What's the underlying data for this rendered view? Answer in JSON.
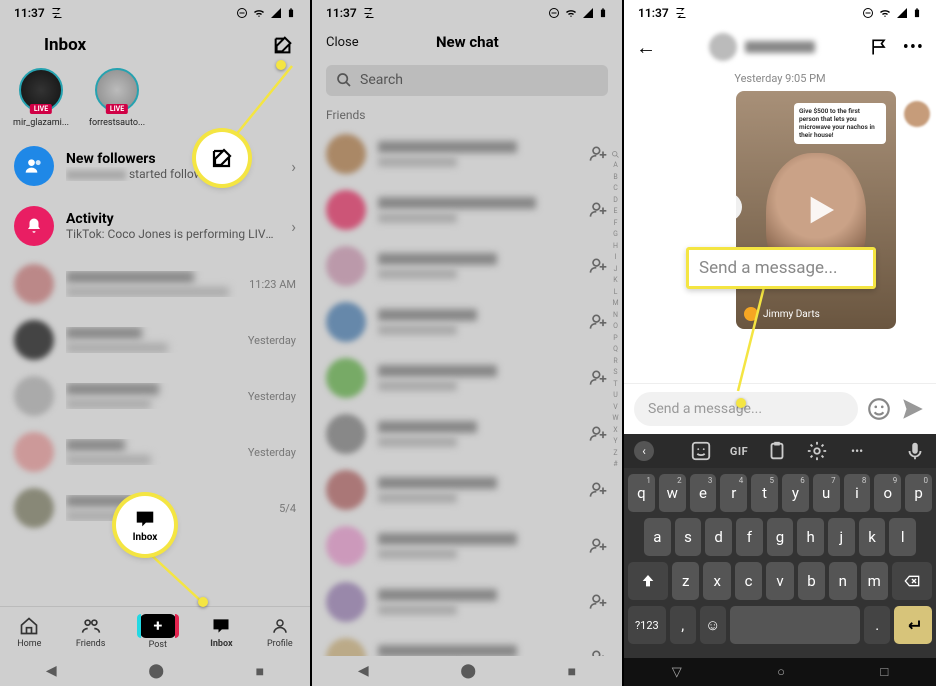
{
  "status_time": "11:37",
  "panel1": {
    "title": "Inbox",
    "stories": [
      "mir_glazami...",
      "forrestsauto..."
    ],
    "new_followers": {
      "title": "New followers",
      "sub": "started following you."
    },
    "activity": {
      "title": "Activity",
      "sub": "TikTok: Coco Jones is performing LIVE on TikT..."
    },
    "times": [
      "11:23 AM",
      "Yesterday",
      "Yesterday",
      "Yesterday",
      "5/4"
    ],
    "tabs": {
      "home": "Home",
      "friends": "Friends",
      "post": "Post",
      "inbox": "Inbox",
      "profile": "Profile"
    },
    "highlight_label": "Inbox"
  },
  "panel2": {
    "close": "Close",
    "title": "New chat",
    "search_placeholder": "Search",
    "section": "Friends",
    "alpha": [
      "A",
      "B",
      "C",
      "D",
      "E",
      "F",
      "G",
      "H",
      "I",
      "J",
      "K",
      "L",
      "M",
      "N",
      "O",
      "P",
      "Q",
      "R",
      "S",
      "T",
      "U",
      "V",
      "W",
      "X",
      "Y",
      "Z",
      "#"
    ]
  },
  "panel3": {
    "timestamp": "Yesterday 9:05 PM",
    "caption": "Give $500 to the first person that lets you microwave your nachos in their house!",
    "sender": "Jimmy Darts",
    "compose_placeholder": "Send a message...",
    "highlight_text": "Send a message...",
    "gif": "GIF",
    "sym": "?123",
    "keys_row1": [
      [
        "q",
        "1"
      ],
      [
        "w",
        "2"
      ],
      [
        "e",
        "3"
      ],
      [
        "r",
        "4"
      ],
      [
        "t",
        "5"
      ],
      [
        "y",
        "6"
      ],
      [
        "u",
        "7"
      ],
      [
        "i",
        "8"
      ],
      [
        "o",
        "9"
      ],
      [
        "p",
        "0"
      ]
    ],
    "keys_row2": [
      "a",
      "s",
      "d",
      "f",
      "g",
      "h",
      "j",
      "k",
      "l"
    ],
    "keys_row3": [
      "z",
      "x",
      "c",
      "v",
      "b",
      "n",
      "m"
    ]
  }
}
